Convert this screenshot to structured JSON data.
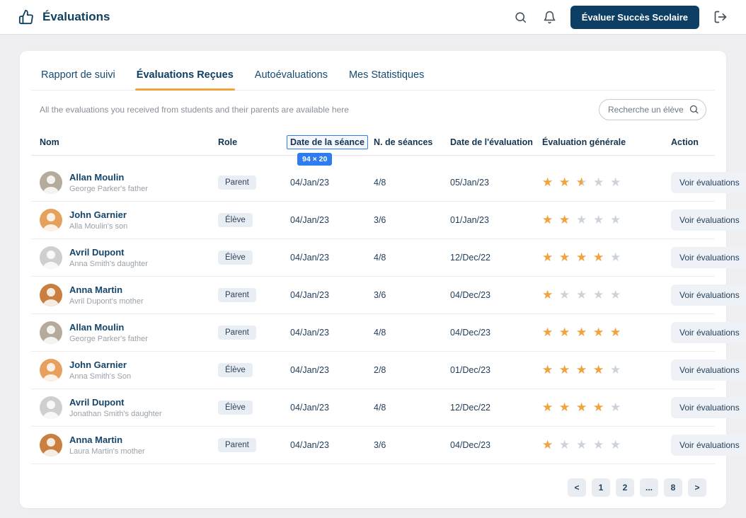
{
  "header": {
    "app_title": "Évaluations",
    "cta_label": "Évaluer Succès Scolaire"
  },
  "tabs": [
    {
      "label": "Rapport de suivi",
      "active": false
    },
    {
      "label": "Évaluations Reçues",
      "active": true
    },
    {
      "label": "Autoévaluations",
      "active": false
    },
    {
      "label": "Mes Statistiques",
      "active": false
    }
  ],
  "subheader": {
    "description": "All the evaluations you received from students and their parents are available here",
    "search_placeholder": "Recherche un élève"
  },
  "table": {
    "columns": [
      "Nom",
      "Role",
      "Date de la séance",
      "N. de séances",
      "Date de l'évaluation",
      "Évaluation générale",
      "Action"
    ],
    "measured_column_index": 2,
    "action_label": "Voir évaluations",
    "rows": [
      {
        "name": "Allan Moulin",
        "subtitle": "George Parker's father",
        "role": "Parent",
        "session_date": "04/Jan/23",
        "sessions": "4/8",
        "evaluation_date": "05/Jan/23",
        "rating": 2.5,
        "avatar_color": "#b4ab9d"
      },
      {
        "name": "John Garnier",
        "subtitle": "Alla Moulin's son",
        "role": "Élève",
        "session_date": "04/Jan/23",
        "sessions": "3/6",
        "evaluation_date": "01/Jan/23",
        "rating": 2,
        "avatar_color": "#e8a15c"
      },
      {
        "name": "Avril Dupont",
        "subtitle": "Anna Smith's daughter",
        "role": "Élève",
        "session_date": "04/Jan/23",
        "sessions": "4/8",
        "evaluation_date": "12/Dec/22",
        "rating": 4,
        "avatar_color": "#cfcfcf"
      },
      {
        "name": "Anna Martin",
        "subtitle": "Avril Dupont's mother",
        "role": "Parent",
        "session_date": "04/Jan/23",
        "sessions": "3/6",
        "evaluation_date": "04/Dec/23",
        "rating": 1,
        "avatar_color": "#c97f3f"
      },
      {
        "name": "Allan Moulin",
        "subtitle": "George Parker's father",
        "role": "Parent",
        "session_date": "04/Jan/23",
        "sessions": "4/8",
        "evaluation_date": "04/Dec/23",
        "rating": 5,
        "avatar_color": "#b4ab9d"
      },
      {
        "name": "John Garnier",
        "subtitle": "Anna Smith's Son",
        "role": "Élève",
        "session_date": "04/Jan/23",
        "sessions": "2/8",
        "evaluation_date": "01/Dec/23",
        "rating": 4,
        "avatar_color": "#e8a15c"
      },
      {
        "name": "Avril Dupont",
        "subtitle": "Jonathan Smith's daughter",
        "role": "Élève",
        "session_date": "04/Jan/23",
        "sessions": "4/8",
        "evaluation_date": "12/Dec/22",
        "rating": 4,
        "avatar_color": "#cfcfcf"
      },
      {
        "name": "Anna Martin",
        "subtitle": "Laura Martin's mother",
        "role": "Parent",
        "session_date": "04/Jan/23",
        "sessions": "3/6",
        "evaluation_date": "04/Dec/23",
        "rating": 1,
        "avatar_color": "#c97f3f"
      }
    ]
  },
  "pagination": {
    "items": [
      "<",
      "1",
      "2",
      "...",
      "8",
      ">"
    ]
  },
  "overlay": {
    "size_label": "94 × 20",
    "color": "#2e7df0"
  },
  "colors": {
    "accent": "#f2a33c",
    "primary": "#0d3e63",
    "star_empty": "#cdd3db"
  }
}
